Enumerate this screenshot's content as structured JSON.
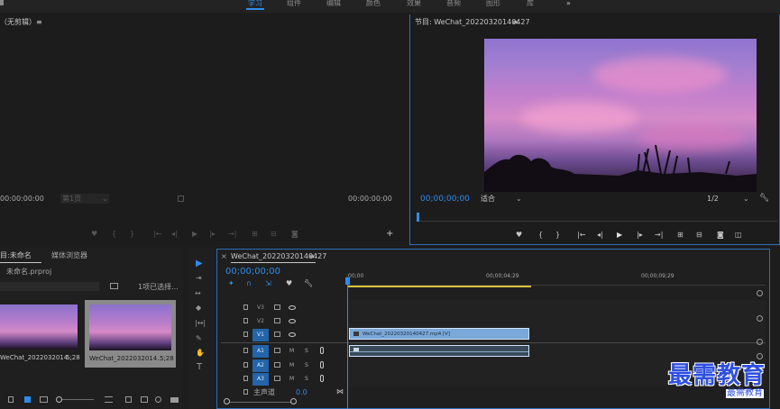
{
  "workspace": {
    "tabs": [
      "学习",
      "组件",
      "编辑",
      "颜色",
      "效果",
      "音频",
      "图形",
      "库"
    ],
    "active_tab": "学习",
    "overflow_label": "»"
  },
  "source_monitor": {
    "title": "（无剪辑）≡",
    "timecode_left": "00:00:00:00",
    "scale_label": "第1页",
    "timecode_right": "00:00:00:00"
  },
  "program_monitor": {
    "title": "节目: WeChat_20220320140427",
    "menu_glyph": "≡",
    "timecode": "00;00;00;00",
    "fit_label": "适合",
    "resolution_label": "1/2"
  },
  "project_panel": {
    "tab_project": "目:未命名",
    "tab_media_browser": "媒体浏览器",
    "project_file": "未命名.prproj",
    "selection_status": "1项已选择...",
    "items": [
      {
        "name": "WeChat_2022032014...",
        "duration": "5;28"
      },
      {
        "name": "WeChat_2022032014...",
        "duration": "5;28"
      }
    ]
  },
  "timeline": {
    "sequence_tab": "WeChat_20220320140427",
    "menu_glyph": "≡",
    "timecode": "00;00;00;00",
    "ruler": [
      ";00;00",
      "00;00;04;29",
      "00;00;09;29"
    ],
    "video_tracks": [
      "V3",
      "V2",
      "V1"
    ],
    "audio_tracks": [
      "A1",
      "A2",
      "A3"
    ],
    "mute_label": "M",
    "solo_label": "S",
    "master_label": "主声道",
    "master_value": "0.0",
    "video_clip_label": "WeChat_20220320140427.mp4 [V]"
  },
  "watermark": {
    "text": "最需教育",
    "subtext": "最需教育"
  },
  "colors": {
    "accent": "#2d8ceb",
    "panel_bg": "#1f1f1f",
    "video_clip": "#7aa8d8",
    "watermark": "#2f4fe0"
  }
}
